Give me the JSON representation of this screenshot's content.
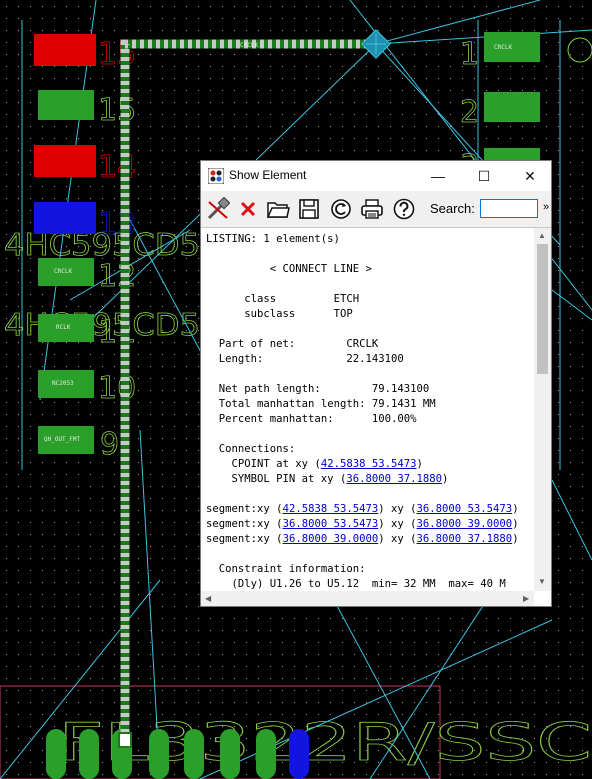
{
  "window": {
    "title": "Show Element",
    "minimize_glyph": "—",
    "maximize_glyph": "☐",
    "close_glyph": "✕"
  },
  "toolbar": {
    "search_label": "Search:",
    "search_value": "",
    "more_glyph": "»",
    "icons": [
      "pin-eraser-icon",
      "close-red-x-icon",
      "open-folder-icon",
      "save-disk-icon",
      "refresh-icon",
      "printer-icon",
      "help-icon"
    ]
  },
  "listing": {
    "header": "LISTING: 1 element(s)",
    "element_type": "< CONNECT LINE >",
    "class_label": "class",
    "class_value": "ETCH",
    "subclass_label": "subclass",
    "subclass_value": "TOP",
    "part_of_net_label": "Part of net:",
    "part_of_net_value": "CRCLK",
    "length_label": "Length:",
    "length_value": "22.143100",
    "net_path_length_label": "Net path length:",
    "net_path_length_value": "79.143100",
    "total_manhattan_label": "Total manhattan length:",
    "total_manhattan_value": "79.1431 MM",
    "percent_manhattan_label": "Percent manhattan:",
    "percent_manhattan_value": "100.00%",
    "connections_label": "Connections:",
    "connections": [
      {
        "prefix": "CPOINT at xy ",
        "coord": "42.5838 53.5473"
      },
      {
        "prefix": "SYMBOL PIN at xy ",
        "coord": "36.8000 37.1880"
      }
    ],
    "segments": [
      {
        "prefix": "segment:xy ",
        "a": "42.5838 53.5473",
        "b": "36.8000 53.5473"
      },
      {
        "prefix": "segment:xy ",
        "a": "36.8000 53.5473",
        "b": "36.8000 39.0000"
      },
      {
        "prefix": "segment:xy ",
        "a": "36.8000 39.0000",
        "b": "36.8000 37.1880"
      }
    ],
    "constraint_label": "Constraint information:",
    "constraint_line": "(Dly) U1.26 to U5.12  min= 32 MM  max= 40 M"
  },
  "pcb": {
    "trace_label": "CRCLK",
    "pad_labels": [
      "CRCLK",
      "RCLK",
      "NC2053",
      "QH_OUT_FMT"
    ],
    "pin_numbers_left": [
      "15",
      "15",
      "14",
      "13",
      "12",
      "11",
      "10",
      "9"
    ],
    "pin_numbers_right": [
      "1",
      "2",
      "3"
    ],
    "silk_text_left": "4HC595CD5",
    "silk_text_bottom": "FL3322R/SSC",
    "colors": {
      "trace_green": "#1b7a1b",
      "trace_grey": "#c8c8c8",
      "pad_green": "#2aa02a",
      "pad_red": "#dd0000",
      "pad_blue": "#1414e0",
      "ratsnest": "#3cc3e0",
      "silk": "#88cc44",
      "outline": "#cc3366"
    }
  }
}
